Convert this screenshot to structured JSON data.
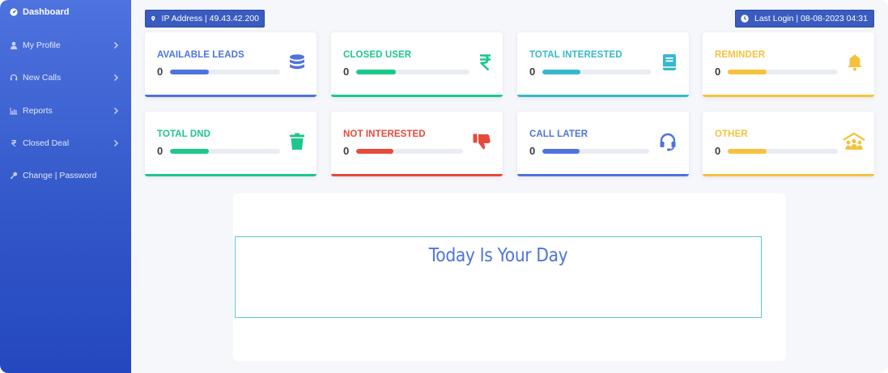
{
  "colors": {
    "blue": "#4e73df",
    "green": "#1cc88a",
    "teal": "#36b9cc",
    "yellow": "#f6c23e",
    "red": "#e74a3b"
  },
  "sidebar": {
    "items": [
      {
        "label": "Dashboard",
        "icon": "dashboard-icon",
        "active": true
      },
      {
        "label": "My Profile",
        "icon": "user-icon"
      },
      {
        "label": "New Calls",
        "icon": "headset-icon"
      },
      {
        "label": "Reports",
        "icon": "chart-icon"
      },
      {
        "label": "Closed Deal",
        "icon": "rupee-icon"
      },
      {
        "label": "Change | Password",
        "icon": "key-icon"
      }
    ]
  },
  "header": {
    "ip": "IP Address | 49.43.42.200",
    "last_login": "Last Login | 08-08-2023 04:31"
  },
  "cards": [
    {
      "label": "AVAILABLE LEADS",
      "value": "0",
      "color": "#4e73df",
      "icon": "database-icon",
      "progress": 0.35
    },
    {
      "label": "CLOSED USER",
      "value": "0",
      "color": "#1cc88a",
      "icon": "rupee-icon",
      "progress": 0.35
    },
    {
      "label": "TOTAL INTERESTED",
      "value": "0",
      "color": "#36b9cc",
      "icon": "book-icon",
      "progress": 0.35
    },
    {
      "label": "REMINDER",
      "value": "0",
      "color": "#f6c23e",
      "icon": "bell-icon",
      "progress": 0.35
    },
    {
      "label": "TOTAL DND",
      "value": "0",
      "color": "#1cc88a",
      "icon": "trash-icon",
      "progress": 0.35
    },
    {
      "label": "NOT INTERESTED",
      "value": "0",
      "color": "#e74a3b",
      "icon": "thumbs-down-icon",
      "progress": 0.35
    },
    {
      "label": "CALL LATER",
      "value": "0",
      "color": "#4e73df",
      "icon": "headset-icon",
      "progress": 0.35
    },
    {
      "label": "OTHER",
      "value": "0",
      "color": "#f6c23e",
      "icon": "people-roof-icon",
      "progress": 0.35
    }
  ],
  "panel": {
    "quote": "Today Is Your Day"
  }
}
